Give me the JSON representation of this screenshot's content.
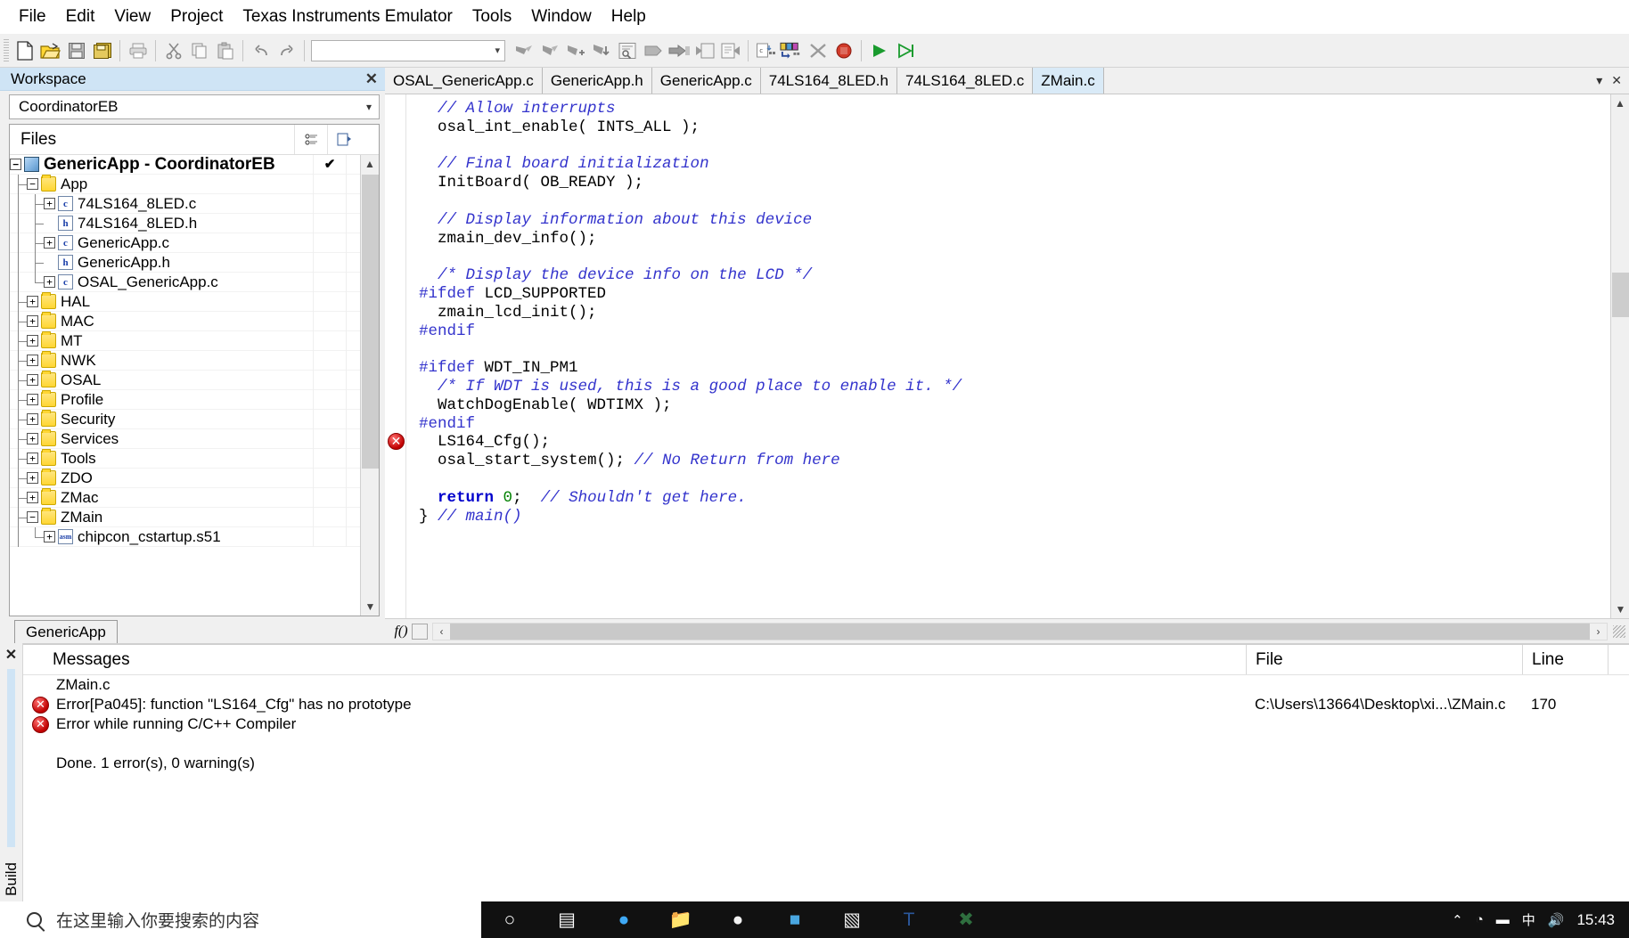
{
  "menubar": {
    "items": [
      {
        "label": "File"
      },
      {
        "label": "Edit"
      },
      {
        "label": "View"
      },
      {
        "label": "Project"
      },
      {
        "label": "Texas Instruments Emulator"
      },
      {
        "label": "Tools"
      },
      {
        "label": "Window"
      },
      {
        "label": "Help"
      }
    ]
  },
  "toolbar": {
    "combo_value": "",
    "buttons": [
      {
        "name": "new-document",
        "glyph": "⬜"
      },
      {
        "name": "open-folder",
        "glyph": "📂"
      },
      {
        "name": "save",
        "glyph": "💾"
      },
      {
        "name": "save-all",
        "glyph": "🖫"
      },
      {
        "name": "print",
        "glyph": "🖨"
      },
      {
        "name": "cut",
        "glyph": "✂"
      },
      {
        "name": "copy",
        "glyph": "⧉"
      },
      {
        "name": "paste",
        "glyph": "📋"
      },
      {
        "name": "undo",
        "glyph": "↶"
      },
      {
        "name": "redo",
        "glyph": "↷"
      },
      {
        "name": "bookmark-toggle",
        "glyph": "➤"
      },
      {
        "name": "bookmark-next",
        "glyph": "➤"
      },
      {
        "name": "bookmark-add",
        "glyph": "➤"
      },
      {
        "name": "bookmark-goto",
        "glyph": "➤"
      },
      {
        "name": "find-in-files",
        "glyph": "❐"
      },
      {
        "name": "compile",
        "glyph": "▶"
      },
      {
        "name": "make",
        "glyph": "➡"
      },
      {
        "name": "stop-build",
        "glyph": "⧉"
      },
      {
        "name": "debug-file",
        "glyph": "⧉"
      },
      {
        "name": "c-spy-debug",
        "glyph": "⧉"
      },
      {
        "name": "variables-watch",
        "glyph": "⧉"
      },
      {
        "name": "breakpoint-toggle",
        "glyph": "✖"
      },
      {
        "name": "stop-debug",
        "glyph": "⛔"
      },
      {
        "name": "run",
        "glyph": "▶"
      },
      {
        "name": "step",
        "glyph": "▷"
      }
    ]
  },
  "workspace": {
    "title": "Workspace",
    "close_label": "✕",
    "config_value": "CoordinatorEB",
    "files_header": "Files",
    "tab_label": "GenericApp",
    "tree": [
      {
        "depth": 0,
        "expander": "−",
        "icon": "cube",
        "label": "GenericApp - CoordinatorEB",
        "check": "✔",
        "star": "",
        "root": true,
        "guides": []
      },
      {
        "depth": 1,
        "expander": "−",
        "icon": "folder",
        "label": "App",
        "check": "",
        "star": "",
        "root": false,
        "guides": [
          "tee"
        ]
      },
      {
        "depth": 2,
        "expander": "+",
        "icon": "file-c",
        "label": "74LS164_8LED.c",
        "check": "",
        "star": "*",
        "root": false,
        "guides": [
          "v",
          "tee"
        ]
      },
      {
        "depth": 2,
        "expander": "",
        "icon": "file-h",
        "label": "74LS164_8LED.h",
        "check": "",
        "star": "",
        "root": false,
        "guides": [
          "v",
          "tee"
        ]
      },
      {
        "depth": 2,
        "expander": "+",
        "icon": "file-c",
        "label": "GenericApp.c",
        "check": "",
        "star": "*",
        "root": false,
        "guides": [
          "v",
          "tee"
        ]
      },
      {
        "depth": 2,
        "expander": "",
        "icon": "file-h",
        "label": "GenericApp.h",
        "check": "",
        "star": "",
        "root": false,
        "guides": [
          "v",
          "tee"
        ]
      },
      {
        "depth": 2,
        "expander": "+",
        "icon": "file-c",
        "label": "OSAL_GenericApp.c",
        "check": "",
        "star": "*",
        "root": false,
        "guides": [
          "v",
          "ell"
        ]
      },
      {
        "depth": 1,
        "expander": "+",
        "icon": "folder",
        "label": "HAL",
        "check": "",
        "star": "*",
        "root": false,
        "guides": [
          "tee"
        ]
      },
      {
        "depth": 1,
        "expander": "+",
        "icon": "folder",
        "label": "MAC",
        "check": "",
        "star": "*",
        "root": false,
        "guides": [
          "tee"
        ]
      },
      {
        "depth": 1,
        "expander": "+",
        "icon": "folder",
        "label": "MT",
        "check": "",
        "star": "*",
        "root": false,
        "guides": [
          "tee"
        ]
      },
      {
        "depth": 1,
        "expander": "+",
        "icon": "folder",
        "label": "NWK",
        "check": "",
        "star": "*",
        "root": false,
        "guides": [
          "tee"
        ]
      },
      {
        "depth": 1,
        "expander": "+",
        "icon": "folder",
        "label": "OSAL",
        "check": "",
        "star": "*",
        "root": false,
        "guides": [
          "tee"
        ]
      },
      {
        "depth": 1,
        "expander": "+",
        "icon": "folder",
        "label": "Profile",
        "check": "",
        "star": "*",
        "root": false,
        "guides": [
          "tee"
        ]
      },
      {
        "depth": 1,
        "expander": "+",
        "icon": "folder",
        "label": "Security",
        "check": "",
        "star": "",
        "root": false,
        "guides": [
          "tee"
        ]
      },
      {
        "depth": 1,
        "expander": "+",
        "icon": "folder",
        "label": "Services",
        "check": "",
        "star": "*",
        "root": false,
        "guides": [
          "tee"
        ]
      },
      {
        "depth": 1,
        "expander": "+",
        "icon": "folder",
        "label": "Tools",
        "check": "",
        "star": "",
        "root": false,
        "guides": [
          "tee"
        ]
      },
      {
        "depth": 1,
        "expander": "+",
        "icon": "folder",
        "label": "ZDO",
        "check": "",
        "star": "*",
        "root": false,
        "guides": [
          "tee"
        ]
      },
      {
        "depth": 1,
        "expander": "+",
        "icon": "folder",
        "label": "ZMac",
        "check": "",
        "star": "*",
        "root": false,
        "guides": [
          "tee"
        ]
      },
      {
        "depth": 1,
        "expander": "−",
        "icon": "folder",
        "label": "ZMain",
        "check": "",
        "star": "",
        "root": false,
        "guides": [
          "tee"
        ]
      },
      {
        "depth": 2,
        "expander": "+",
        "icon": "file-asm",
        "label": "chipcon_cstartup.s51",
        "check": "",
        "star": "*",
        "root": false,
        "guides": [
          "v",
          "ell"
        ]
      }
    ]
  },
  "editor": {
    "tabs": [
      {
        "label": "OSAL_GenericApp.c",
        "active": false
      },
      {
        "label": "GenericApp.h",
        "active": false
      },
      {
        "label": "GenericApp.c",
        "active": false
      },
      {
        "label": "74LS164_8LED.h",
        "active": false
      },
      {
        "label": "74LS164_8LED.c",
        "active": false
      },
      {
        "label": "ZMain.c",
        "active": true
      }
    ],
    "tabbar_controls": [
      {
        "name": "tab-list-dropdown",
        "glyph": "▾"
      },
      {
        "name": "close-editor",
        "glyph": "✕"
      }
    ],
    "error_marker_glyph": "✕",
    "fx_label": "f()",
    "scroll_left_glyph": "‹",
    "scroll_right_glyph": "›",
    "code_lines": [
      {
        "segments": [
          {
            "t": "  ",
            "c": ""
          },
          {
            "t": "// Allow interrupts",
            "c": "cm"
          }
        ]
      },
      {
        "segments": [
          {
            "t": "  osal_int_enable( INTS_ALL );",
            "c": ""
          }
        ]
      },
      {
        "segments": [
          {
            "t": "",
            "c": ""
          }
        ]
      },
      {
        "segments": [
          {
            "t": "  ",
            "c": ""
          },
          {
            "t": "// Final board initialization",
            "c": "cm"
          }
        ]
      },
      {
        "segments": [
          {
            "t": "  InitBoard( OB_READY );",
            "c": ""
          }
        ]
      },
      {
        "segments": [
          {
            "t": "",
            "c": ""
          }
        ]
      },
      {
        "segments": [
          {
            "t": "  ",
            "c": ""
          },
          {
            "t": "// Display information about this device",
            "c": "cm"
          }
        ]
      },
      {
        "segments": [
          {
            "t": "  zmain_dev_info();",
            "c": ""
          }
        ]
      },
      {
        "segments": [
          {
            "t": "",
            "c": ""
          }
        ]
      },
      {
        "segments": [
          {
            "t": "  ",
            "c": ""
          },
          {
            "t": "/* Display the device info on the LCD */",
            "c": "cm"
          }
        ]
      },
      {
        "segments": [
          {
            "t": "#ifdef",
            "c": "pp"
          },
          {
            "t": " LCD_SUPPORTED",
            "c": ""
          }
        ]
      },
      {
        "segments": [
          {
            "t": "  zmain_lcd_init();",
            "c": ""
          }
        ]
      },
      {
        "segments": [
          {
            "t": "#endif",
            "c": "pp"
          }
        ]
      },
      {
        "segments": [
          {
            "t": "",
            "c": ""
          }
        ]
      },
      {
        "segments": [
          {
            "t": "#ifdef",
            "c": "pp"
          },
          {
            "t": " WDT_IN_PM1",
            "c": ""
          }
        ]
      },
      {
        "segments": [
          {
            "t": "  ",
            "c": ""
          },
          {
            "t": "/* If WDT is used, this is a good place to enable it. */",
            "c": "cm"
          }
        ]
      },
      {
        "segments": [
          {
            "t": "  WatchDogEnable( WDTIMX );",
            "c": ""
          }
        ]
      },
      {
        "segments": [
          {
            "t": "#endif",
            "c": "pp"
          }
        ]
      },
      {
        "segments": [
          {
            "t": "  LS164_Cfg();",
            "c": ""
          }
        ]
      },
      {
        "segments": [
          {
            "t": "  osal_start_system(); ",
            "c": ""
          },
          {
            "t": "// No Return from here",
            "c": "cm"
          }
        ]
      },
      {
        "segments": [
          {
            "t": "",
            "c": ""
          }
        ]
      },
      {
        "segments": [
          {
            "t": "  ",
            "c": ""
          },
          {
            "t": "return",
            "c": "kw"
          },
          {
            "t": " ",
            "c": ""
          },
          {
            "t": "0",
            "c": "num"
          },
          {
            "t": ";  ",
            "c": ""
          },
          {
            "t": "// Shouldn't get here.",
            "c": "cm"
          }
        ]
      },
      {
        "segments": [
          {
            "t": "} ",
            "c": ""
          },
          {
            "t": "// main()",
            "c": "cm"
          }
        ]
      }
    ]
  },
  "build": {
    "panel_label": "Build",
    "close_label": "✕",
    "columns": {
      "messages": "Messages",
      "file": "File",
      "line": "Line"
    },
    "rows": [
      {
        "icon": "none",
        "message": "ZMain.c",
        "file": "",
        "line": "",
        "indent": true
      },
      {
        "icon": "error",
        "message": "Error[Pa045]: function \"LS164_Cfg\" has no prototype",
        "file": "C:\\Users\\13664\\Desktop\\xi...\\ZMain.c",
        "line": "170",
        "indent": false
      },
      {
        "icon": "error",
        "message": "Error while running C/C++ Compiler",
        "file": "",
        "line": "",
        "indent": false
      },
      {
        "icon": "none",
        "message": "",
        "file": "",
        "line": "",
        "indent": true
      },
      {
        "icon": "none",
        "message": "Done. 1 error(s), 0 warning(s)",
        "file": "",
        "line": "",
        "indent": true
      }
    ]
  },
  "taskbar": {
    "search_placeholder": "在这里输入你要搜索的内容",
    "clock_time": "15:43",
    "icons": [
      {
        "name": "cortana-search-icon",
        "glyph": "○"
      },
      {
        "name": "task-view-icon",
        "glyph": "▤"
      },
      {
        "name": "edge-icon",
        "glyph": "●"
      },
      {
        "name": "file-explorer-icon",
        "glyph": "📁"
      },
      {
        "name": "chrome-icon",
        "glyph": "●"
      },
      {
        "name": "store-icon",
        "glyph": "■"
      },
      {
        "name": "notepad-icon",
        "glyph": "▧"
      },
      {
        "name": "word-icon",
        "glyph": "T"
      },
      {
        "name": "iar-workbench-icon",
        "glyph": "✖"
      }
    ],
    "tray": [
      {
        "name": "tray-chevron-up-icon",
        "glyph": "⌃"
      },
      {
        "name": "tray-network-icon",
        "glyph": "◔"
      },
      {
        "name": "tray-battery-icon",
        "glyph": "▬"
      },
      {
        "name": "tray-ime-icon",
        "glyph": "中"
      },
      {
        "name": "tray-volume-icon",
        "glyph": "🔊"
      }
    ]
  }
}
